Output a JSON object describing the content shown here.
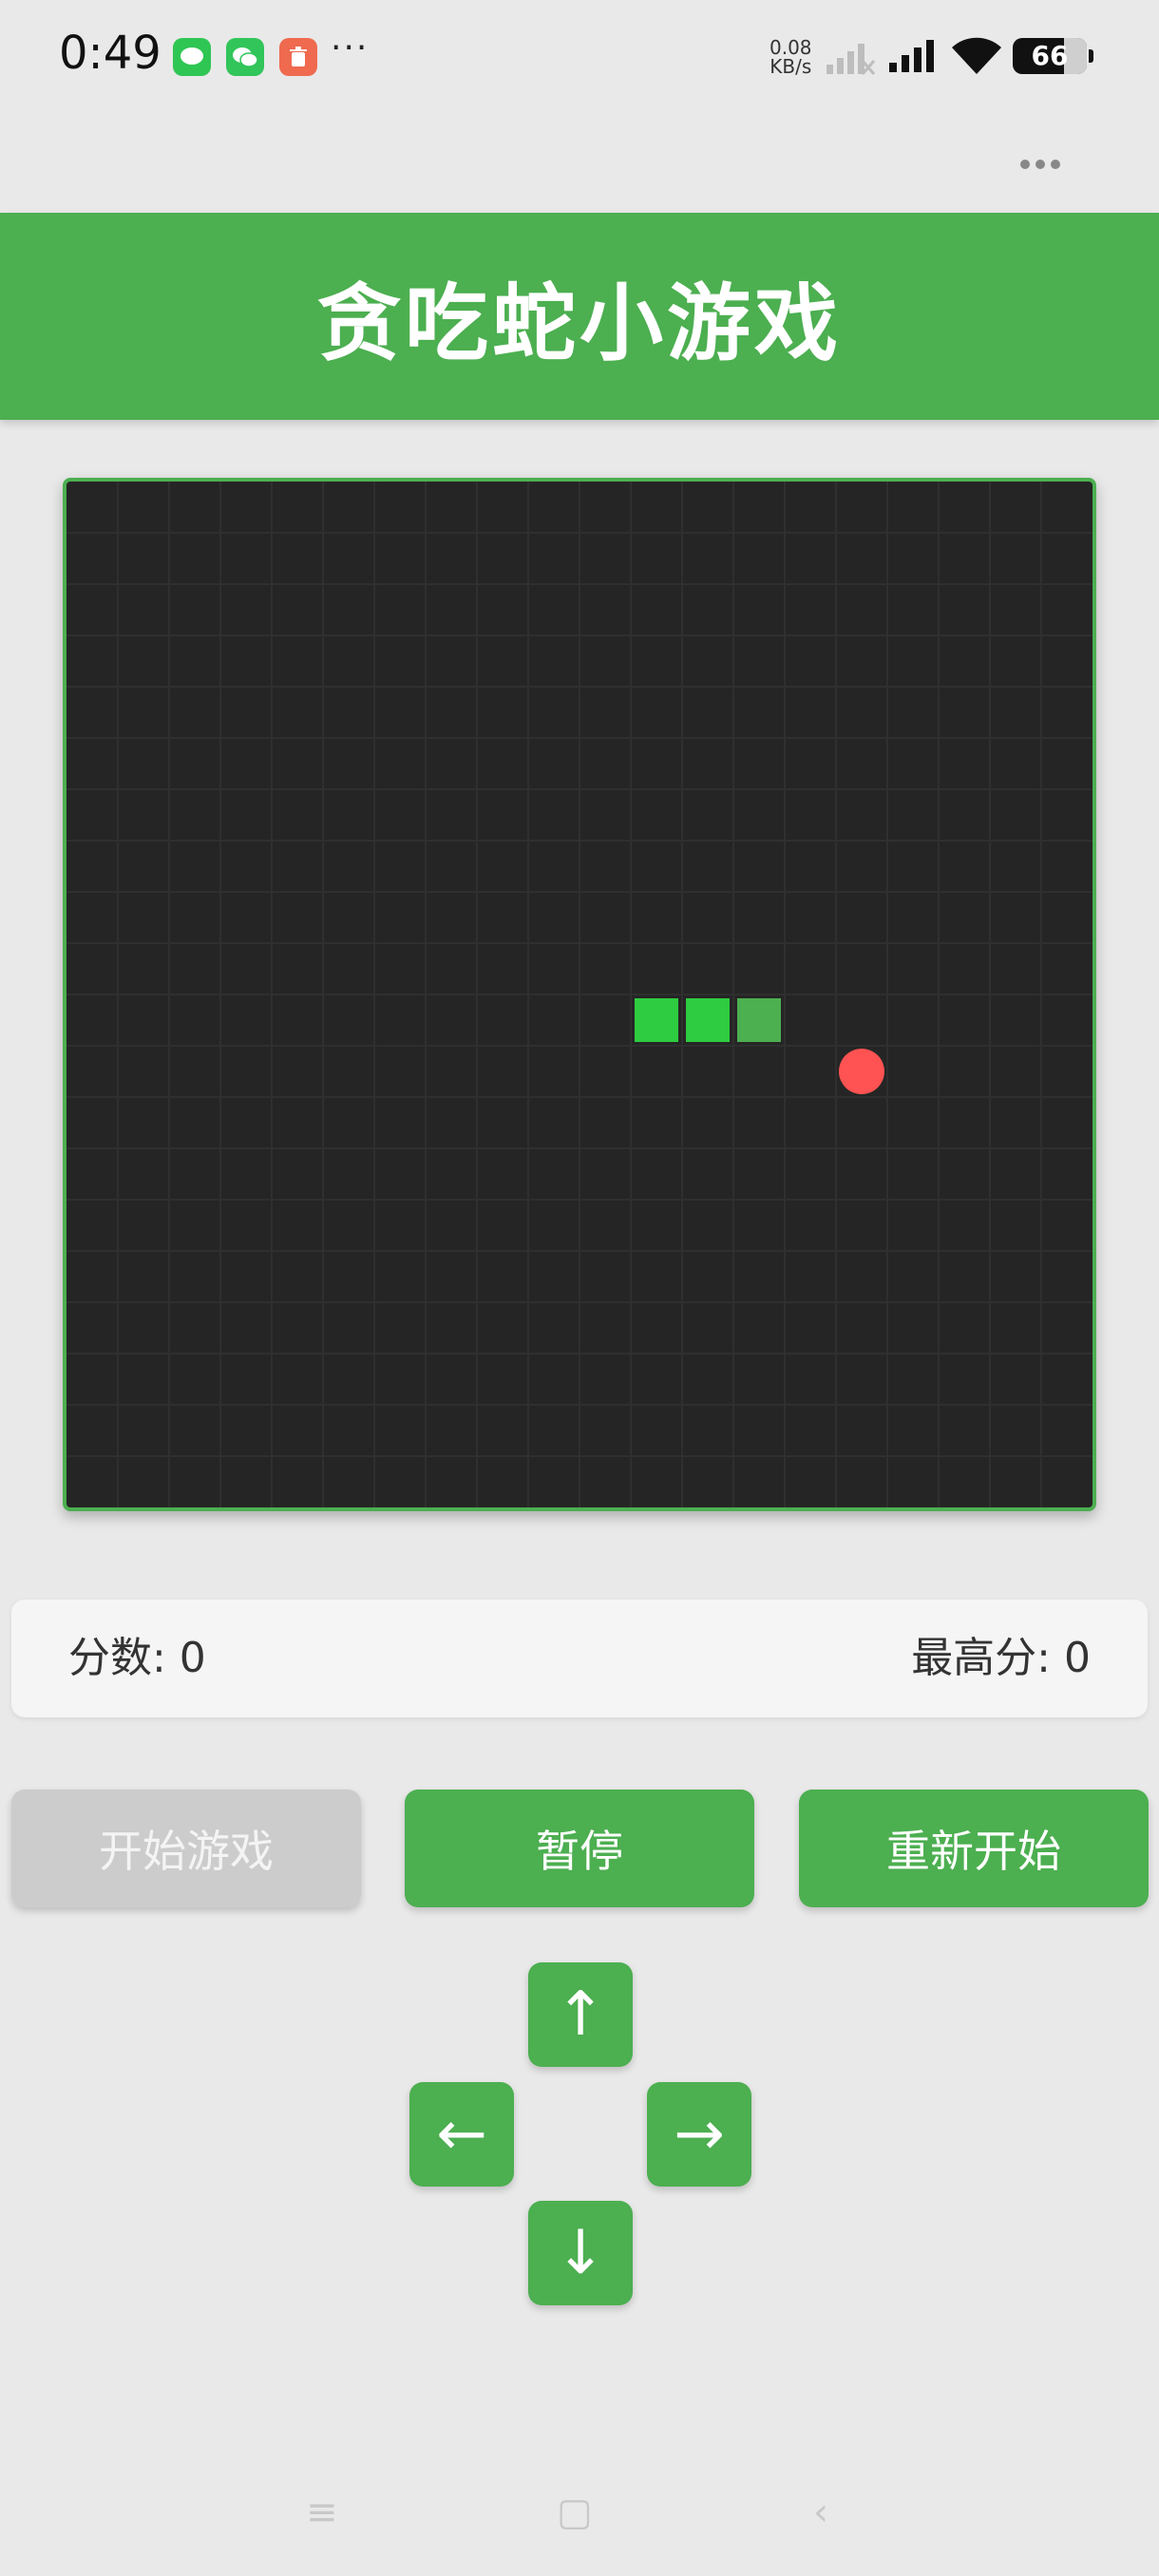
{
  "status_bar": {
    "time": "0:49",
    "net_speed_value": "0.08",
    "net_speed_unit": "KB/s",
    "battery_level": "66",
    "icons": [
      "message-icon",
      "wechat-icon",
      "trash-icon",
      "more-dots-icon",
      "cellular-signal-icon",
      "wifi-icon",
      "battery-icon"
    ]
  },
  "header": {
    "title": "贪吃蛇小游戏"
  },
  "game": {
    "grid_cols": 20,
    "grid_rows": 20,
    "snake": [
      [
        11,
        10
      ],
      [
        12,
        10
      ],
      [
        13,
        10
      ]
    ],
    "food": [
      15,
      11
    ],
    "colors": {
      "board": "#252525",
      "grid": "#2f2f2f",
      "snake_body": "#2ecc40",
      "snake_tail": "#4caf50",
      "food": "#ff5252",
      "accent": "#4caf50"
    }
  },
  "scores": {
    "score_text": "分数: 0",
    "high_score_text": "最高分: 0"
  },
  "controls": {
    "start_label": "开始游戏",
    "pause_label": "暂停",
    "restart_label": "重新开始",
    "up": "↑",
    "left": "←",
    "right": "→",
    "down": "↓"
  },
  "nav": {
    "menu": "≡",
    "home": "▢",
    "back": "‹"
  }
}
